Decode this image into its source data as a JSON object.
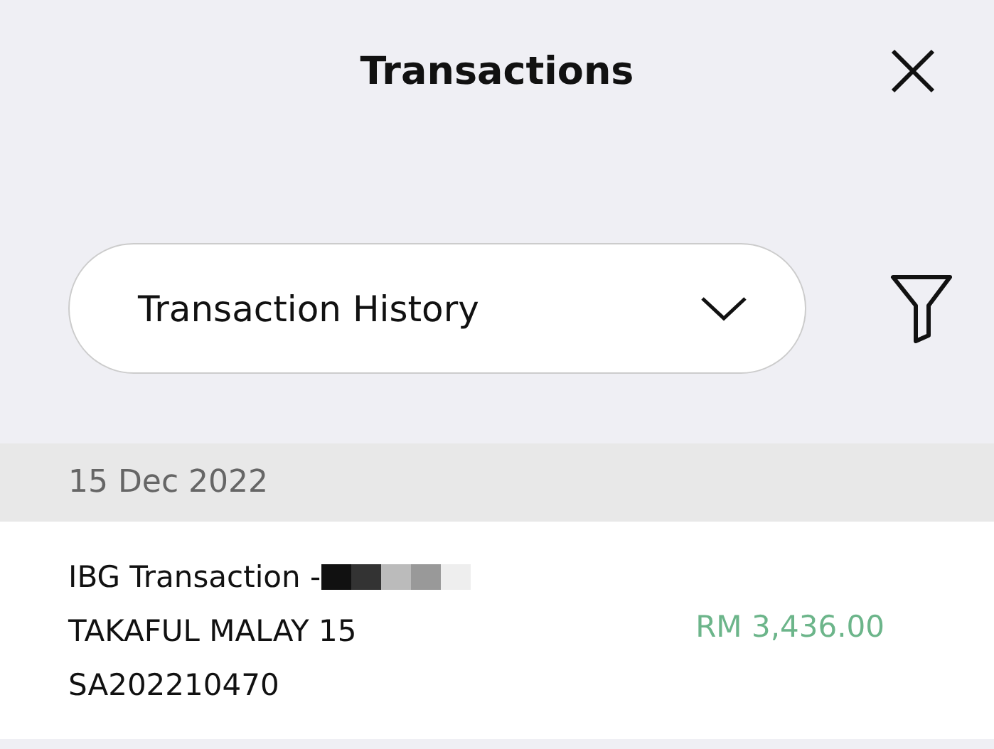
{
  "header": {
    "title": "Transactions"
  },
  "selector": {
    "value": "Transaction History"
  },
  "groups": [
    {
      "date": "15 Dec 2022",
      "transactions": [
        {
          "lines": [
            "IBG Transaction -",
            "TAKAFUL MALAY 15",
            "SA202210470"
          ],
          "redacted": true,
          "amount": "RM 3,436.00"
        }
      ]
    }
  ]
}
